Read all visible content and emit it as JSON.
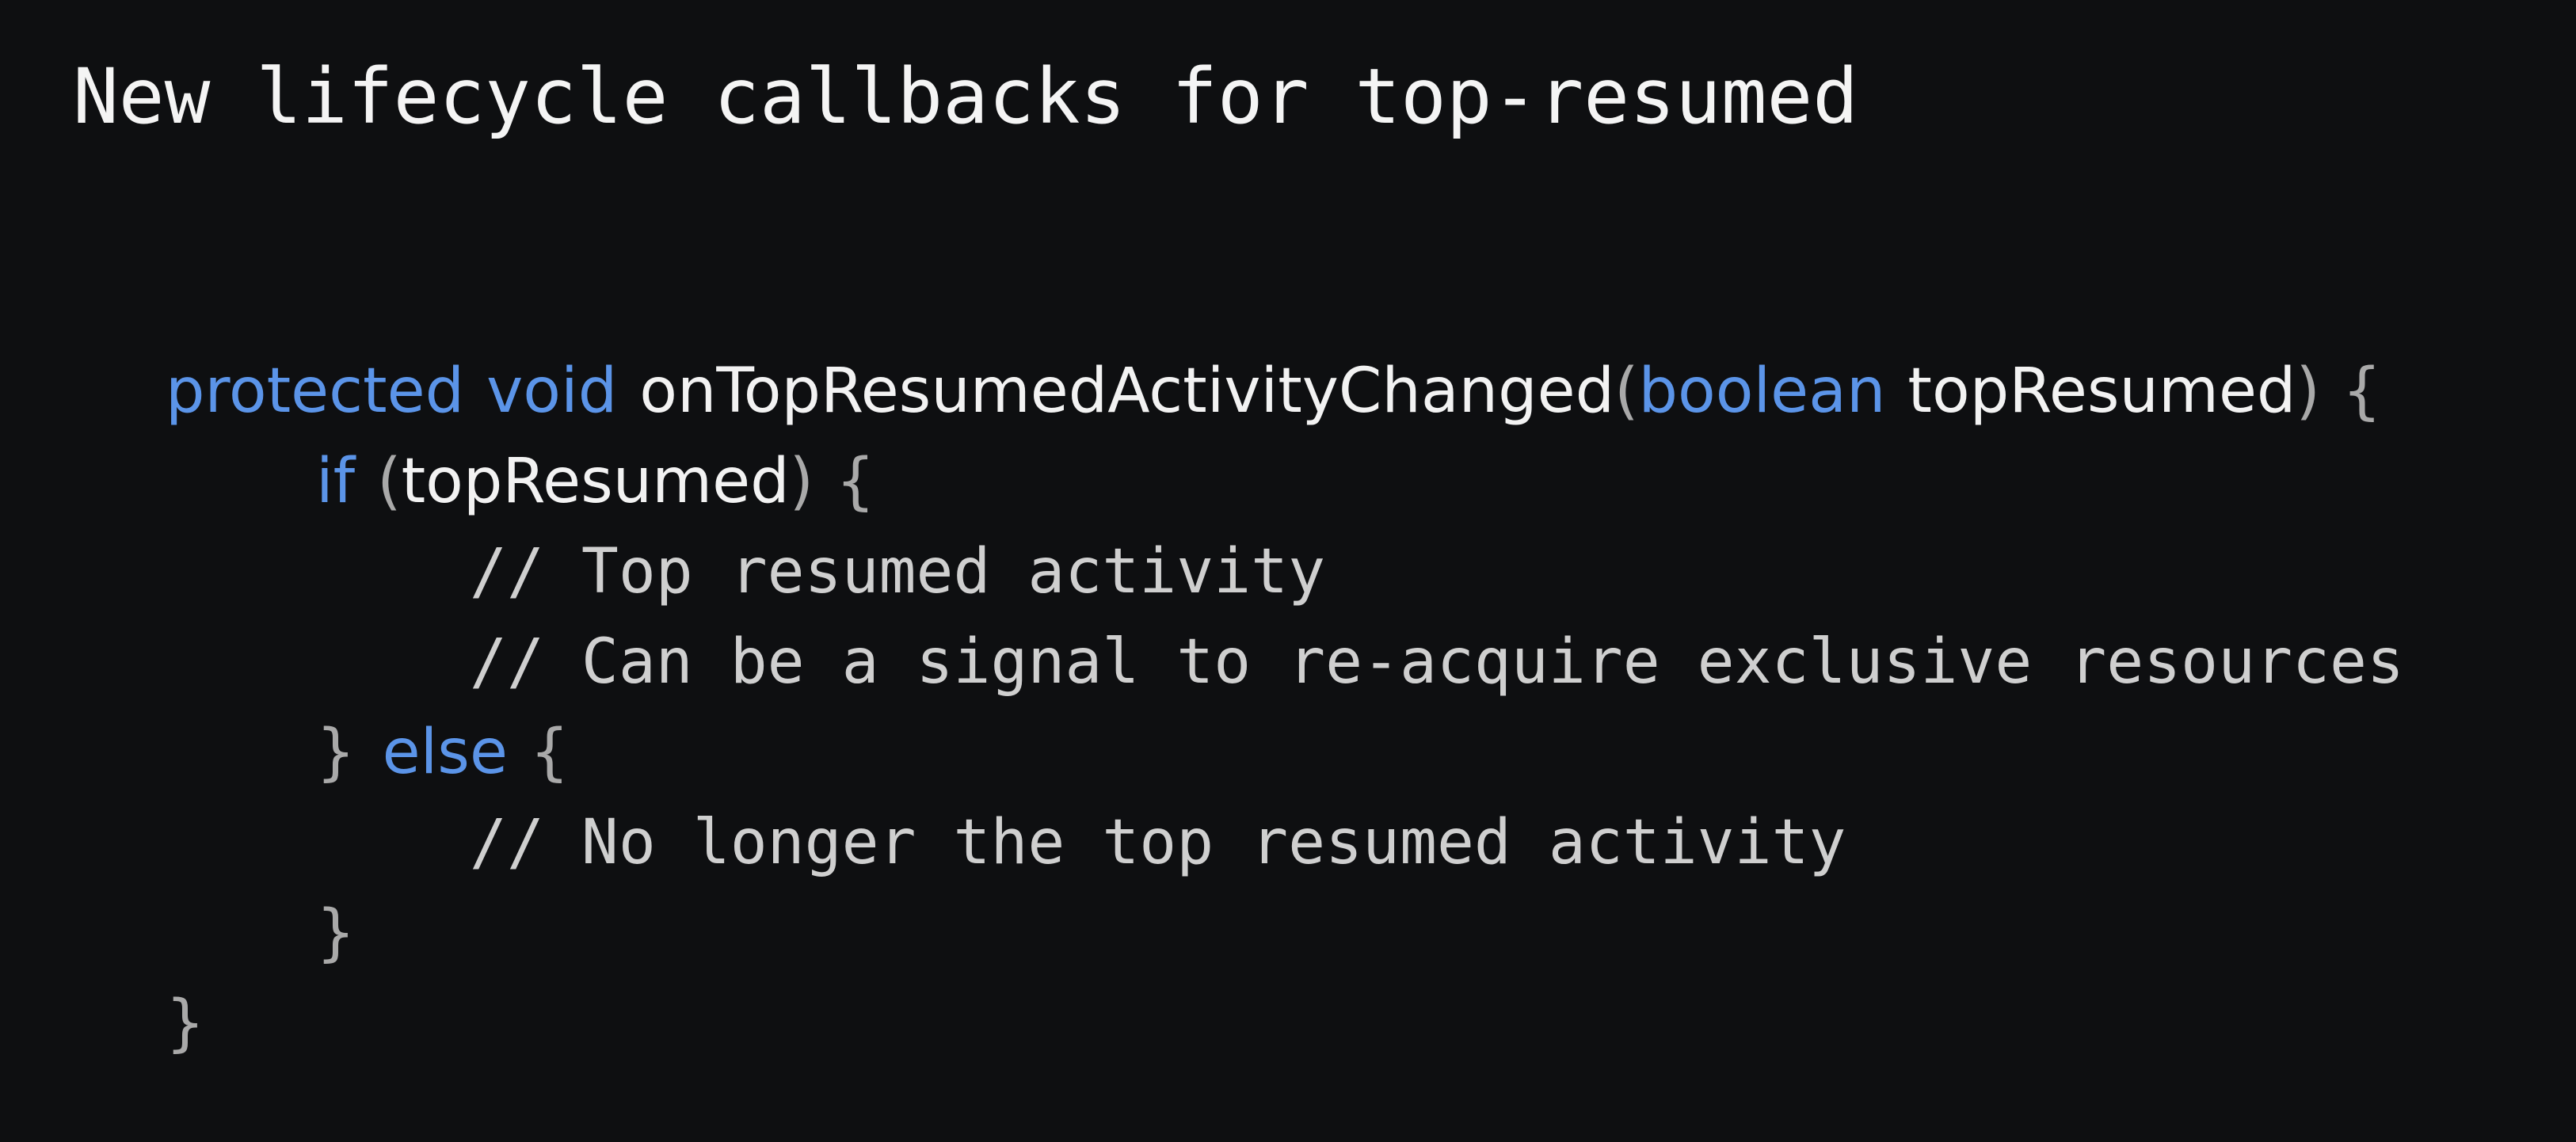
{
  "slide": {
    "title": "New lifecycle callbacks for top-resumed"
  },
  "code": {
    "line1": {
      "kw_protected": "protected",
      "kw_void": "void",
      "method": "onTopResumedActivityChanged",
      "open_paren": "(",
      "kw_boolean": "boolean",
      "param": "topResumed",
      "close_paren": ")",
      "brace": "{"
    },
    "line2": {
      "kw_if": "if",
      "open_paren": "(",
      "cond": "topResumed",
      "close_paren": ")",
      "brace": "{"
    },
    "line3": {
      "comment": "// Top resumed activity"
    },
    "line4": {
      "comment": "// Can be a signal to re-acquire exclusive resources"
    },
    "line5": {
      "close_brace": "}",
      "kw_else": "else",
      "brace": "{"
    },
    "line6": {
      "comment": "// No longer the top resumed activity"
    },
    "line7": {
      "close_brace": "}"
    },
    "line8": {
      "close_brace": "}"
    }
  },
  "colors": {
    "background": "#0e0f11",
    "keyword": "#5b94e8",
    "identifier": "#f2f2f2",
    "punctuation": "#a9a9a9",
    "comment": "#cfcfcf",
    "title": "#f4f4f4"
  }
}
